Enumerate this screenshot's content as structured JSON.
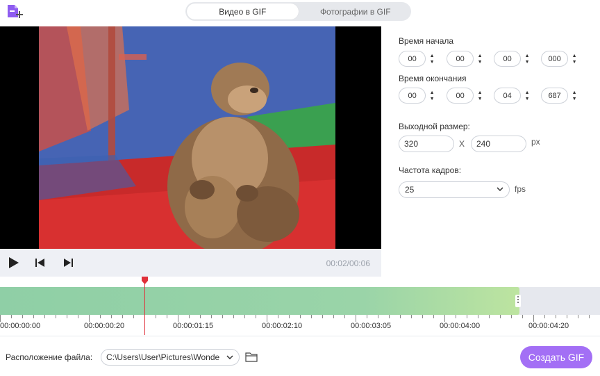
{
  "tabs": [
    {
      "label": "Видео в GIF",
      "active": true
    },
    {
      "label": "Фотографии в GIF",
      "active": false
    }
  ],
  "player": {
    "time_readout": "00:02/00:06"
  },
  "panel": {
    "start_label": "Время начала",
    "start_values": [
      "00",
      "00",
      "00",
      "000"
    ],
    "end_label": "Время окончания",
    "end_values": [
      "00",
      "00",
      "04",
      "687"
    ],
    "size_label": "Выходной размер:",
    "width_value": "320",
    "size_sep": "X",
    "height_value": "240",
    "size_unit": "px",
    "fps_label": "Частота кадров:",
    "fps_value": "25",
    "fps_unit": "fps"
  },
  "timeline": {
    "ticks": [
      "00:00:00:00",
      "00:00:00:20",
      "00:00:01:15",
      "00:00:02:10",
      "00:00:03:05",
      "00:00:04:00",
      "00:00:04:20"
    ]
  },
  "bottom": {
    "location_label": "Расположение файла:",
    "path_value": "C:\\Users\\User\\Pictures\\Wonde",
    "create_label": "Создать GIF"
  },
  "icons": [
    "add-file-icon",
    "play-icon",
    "previous-frame-icon",
    "next-frame-icon",
    "chevron-up-icon",
    "chevron-down-icon",
    "folder-icon",
    "playhead-icon"
  ],
  "colors": {
    "accent": "#a36ff5",
    "clip": "#8fcfa6",
    "playhead": "#e0303a"
  }
}
